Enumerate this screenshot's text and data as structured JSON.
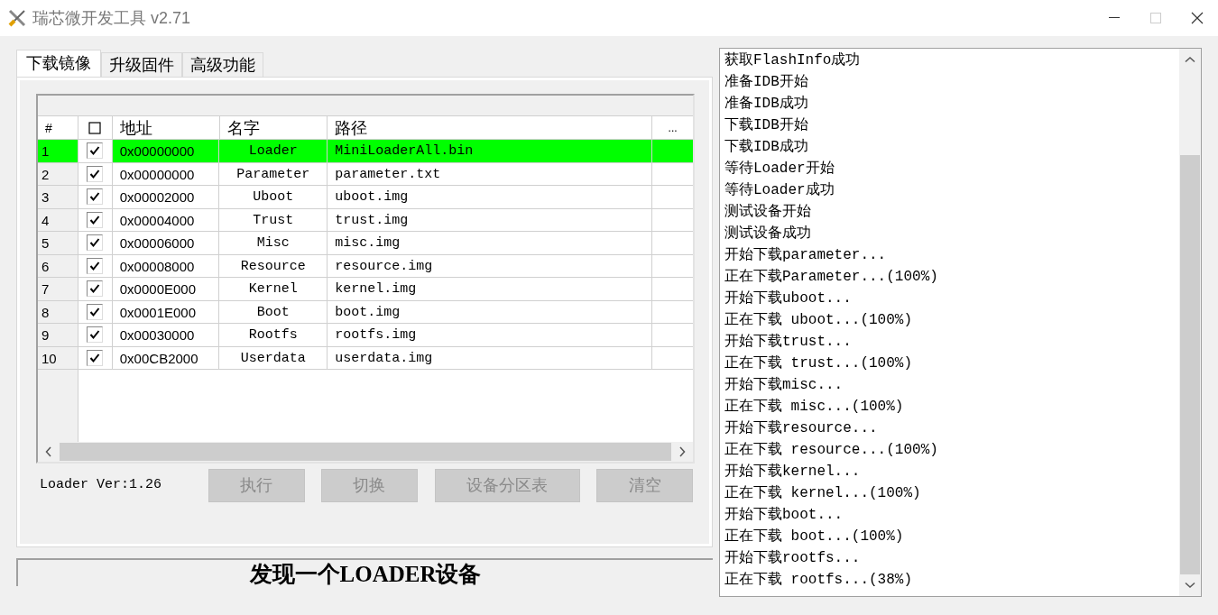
{
  "window": {
    "title": "瑞芯微开发工具 v2.71"
  },
  "tabs": [
    {
      "label": "下载镜像",
      "selected": true
    },
    {
      "label": "升级固件",
      "selected": false
    },
    {
      "label": "高级功能",
      "selected": false
    }
  ],
  "table": {
    "columns": [
      "#",
      "地址",
      "名字",
      "路径",
      "..."
    ],
    "rows": [
      {
        "index": "1",
        "checked": true,
        "selected": true,
        "address": "0x00000000",
        "name": "Loader",
        "path": "MiniLoaderAll.bin"
      },
      {
        "index": "2",
        "checked": true,
        "selected": false,
        "address": "0x00000000",
        "name": "Parameter",
        "path": "parameter.txt"
      },
      {
        "index": "3",
        "checked": true,
        "selected": false,
        "address": "0x00002000",
        "name": "Uboot",
        "path": "uboot.img"
      },
      {
        "index": "4",
        "checked": true,
        "selected": false,
        "address": "0x00004000",
        "name": "Trust",
        "path": "trust.img"
      },
      {
        "index": "5",
        "checked": true,
        "selected": false,
        "address": "0x00006000",
        "name": "Misc",
        "path": "misc.img"
      },
      {
        "index": "6",
        "checked": true,
        "selected": false,
        "address": "0x00008000",
        "name": "Resource",
        "path": "resource.img"
      },
      {
        "index": "7",
        "checked": true,
        "selected": false,
        "address": "0x0000E000",
        "name": "Kernel",
        "path": "kernel.img"
      },
      {
        "index": "8",
        "checked": true,
        "selected": false,
        "address": "0x0001E000",
        "name": "Boot",
        "path": "boot.img"
      },
      {
        "index": "9",
        "checked": true,
        "selected": false,
        "address": "0x00030000",
        "name": "Rootfs",
        "path": "rootfs.img"
      },
      {
        "index": "10",
        "checked": true,
        "selected": false,
        "address": "0x00CB2000",
        "name": "Userdata",
        "path": "userdata.img"
      }
    ]
  },
  "loader_version": "Loader Ver:1.26",
  "buttons": [
    {
      "label": "执行",
      "disabled": true
    },
    {
      "label": "切换",
      "disabled": true
    },
    {
      "label": "设备分区表",
      "disabled": true
    },
    {
      "label": "清空",
      "disabled": true
    }
  ],
  "status": "发现一个LOADER设备",
  "log": [
    "获取FlashInfo成功",
    "准备IDB开始",
    "准备IDB成功",
    "下载IDB开始",
    "下载IDB成功",
    "等待Loader开始",
    "等待Loader成功",
    "测试设备开始",
    "测试设备成功",
    "开始下载parameter...",
    "正在下载Parameter...(100%)",
    "开始下载uboot...",
    "正在下载 uboot...(100%)",
    "开始下载trust...",
    "正在下载 trust...(100%)",
    "开始下载misc...",
    "正在下载 misc...(100%)",
    "开始下载resource...",
    "正在下载 resource...(100%)",
    "开始下载kernel...",
    "正在下载 kernel...(100%)",
    "开始下载boot...",
    "正在下载 boot...(100%)",
    "开始下载rootfs...",
    "正在下载 rootfs...(38%)"
  ]
}
